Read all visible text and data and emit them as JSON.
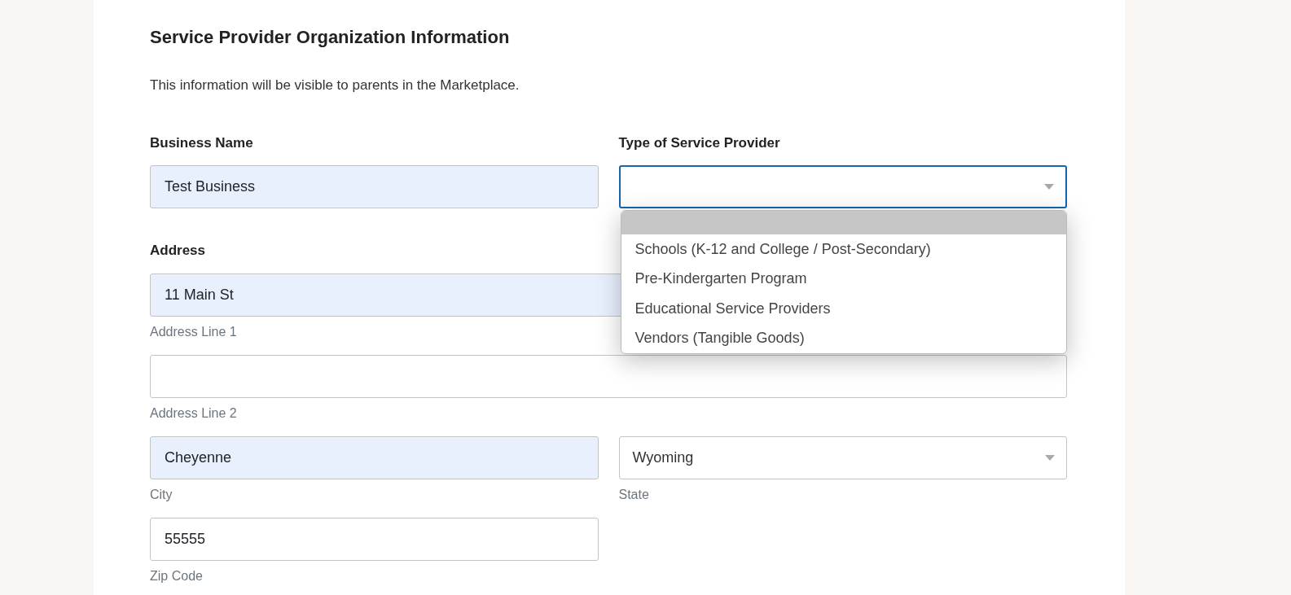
{
  "heading": "Service Provider Organization Information",
  "intro": "This information will be visible to parents in the Marketplace.",
  "business_name": {
    "label": "Business Name",
    "value": "Test Business",
    "autofilled": true
  },
  "provider_type": {
    "label": "Type of Service Provider",
    "focused": true,
    "expanded": true,
    "blank_option_highlighted": true,
    "options": [
      {
        "label": "Schools (K-12 and College / Post-Secondary)"
      },
      {
        "label": "Pre-Kindergarten Program"
      },
      {
        "label": "Educational Service Providers"
      },
      {
        "label": "Vendors (Tangible Goods)"
      }
    ]
  },
  "address": {
    "label": "Address",
    "line_1": {
      "value": "11 Main St",
      "caption": "Address Line 1",
      "autofilled": true
    },
    "line_2": {
      "caption": "Address Line 2",
      "autofilled": false
    },
    "city": {
      "value": "Cheyenne",
      "caption": "City",
      "autofilled": true
    },
    "state": {
      "value": "Wyoming",
      "caption": "State"
    },
    "zip": {
      "value": "55555",
      "caption": "Zip Code",
      "autofilled": false
    }
  }
}
